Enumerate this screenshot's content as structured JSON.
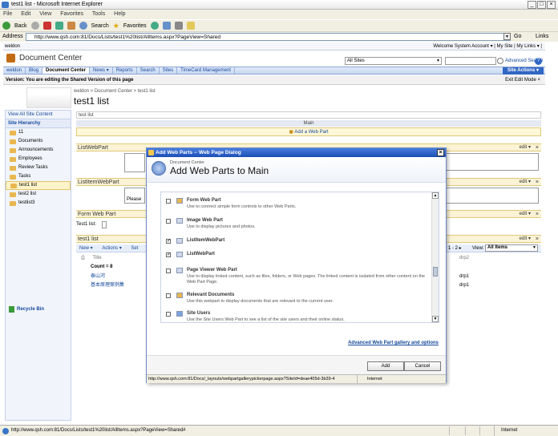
{
  "window": {
    "title": "test1 list - Microsoft Internet Explorer"
  },
  "menu": [
    "File",
    "Edit",
    "View",
    "Favorites",
    "Tools",
    "Help"
  ],
  "toolbar": {
    "back": "Back",
    "search": "Search",
    "favorites": "Favorites"
  },
  "address": {
    "label": "Address",
    "url": "http://www.qsh.com:81/Docs/Lists/test1%20list/AllItems.aspx?PageView=Shared",
    "go": "Go",
    "links": "Links"
  },
  "sp": {
    "user_top": "weldon",
    "welcome": "Welcome System Account ▾  |  My Site  |  My Links ▾  |",
    "site_title": "Document Center",
    "scope": "All Sites",
    "advanced_search": "Advanced Search",
    "nav": [
      "weldon",
      "Blog",
      "Document Center",
      "News ▾",
      "Reports",
      "Search",
      "Sites",
      "TimeCard Management"
    ],
    "site_actions": "Site Actions ▾",
    "version_notice": "Version: You are editing the Shared Version of this page",
    "exit_edit": "Exit Edit Mode ×",
    "breadcrumb": "weldon > Document Center > test1 list",
    "page_title": "test1 list"
  },
  "quicklaunch": {
    "view_all": "View All Site Content",
    "heading": "Site Hierarchy",
    "items": [
      "11",
      "Documents",
      "Announcements",
      "Employees",
      "Review Tasks",
      "Tasks",
      "test1 list",
      "test2 list",
      "testlist3"
    ],
    "selected_index": 6,
    "recycle": "Recycle Bin"
  },
  "zone": {
    "label": "test list",
    "main": "Main",
    "add_web_part": "Add a Web Part",
    "parts": [
      {
        "title": "ListWebPart",
        "edit": "edit ▾",
        "close": "×"
      },
      {
        "title": "ListItemWebPart",
        "edit": "edit ▾",
        "close": "×"
      },
      {
        "title": "Form Web Part",
        "edit": "edit ▾",
        "close": "×"
      },
      {
        "title": "test1 list",
        "edit": "edit ▾",
        "close": "×"
      }
    ],
    "please": "Please ",
    "form_label": "Test1 list:",
    "list_toolbar": {
      "new": "New ▾",
      "actions": "Actions ▾",
      "settings": "Set",
      "page": "1 - 2 ▸",
      "view_label": "View:",
      "view": "All Items"
    },
    "col_title": "Title",
    "col_drp2": "drp2",
    "count": "Count = 8",
    "rows": [
      {
        "title": "泰山河",
        "drp2": "drp1"
      },
      {
        "title": "基本原理案例集",
        "drp2": "drp1"
      }
    ]
  },
  "dialog": {
    "title": "Add Web Parts -- Web Page Dialog",
    "close": "×",
    "subtitle": "Document Center",
    "heading": "Add Web Parts to Main",
    "items": [
      {
        "name": "Form Web Part",
        "desc": "Use to connect simple form controls to other Web Parts.",
        "checked": ""
      },
      {
        "name": "Image Web Part",
        "desc": "Use to display pictures and photos.",
        "checked": ""
      },
      {
        "name": "ListItemWebPart",
        "desc": "",
        "checked": "✓"
      },
      {
        "name": "ListWebPart",
        "desc": "",
        "checked": "✓"
      },
      {
        "name": "Page Viewer Web Part",
        "desc": "Use to display linked content, such as files, folders, or Web pages. The linked content is isolated from other content on the Web Part Page.",
        "checked": ""
      },
      {
        "name": "Relevant Documents",
        "desc": "Use this webpart to display documents that are relevant to the current user.",
        "checked": ""
      },
      {
        "name": "Site Users",
        "desc": "Use the Site Users Web Part to see a list of the site users and their online status.",
        "checked": ""
      }
    ],
    "advanced_link": "Advanced Web Part gallery and options",
    "add": "Add",
    "cancel": "Cancel",
    "status_url": "http://www.qsh.com:81/Docs/_layouts/webpartgallerypickerpage.aspx?SiteId=deae405d-3b39-4",
    "status_zone": "Internet"
  },
  "status": {
    "url": "http://www.qsh.com:81/Docs/Lists/test1%20list/AllItems.aspx?PageView=Shared#",
    "zone": "Internet"
  }
}
